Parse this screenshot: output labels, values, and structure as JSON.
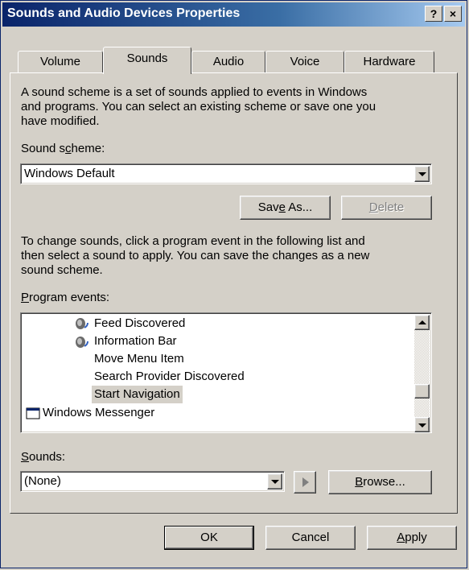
{
  "window": {
    "title": "Sounds and Audio Devices Properties",
    "help_label": "?",
    "close_label": "×"
  },
  "tabs": [
    {
      "label": "Volume",
      "active": false
    },
    {
      "label": "Sounds",
      "active": true
    },
    {
      "label": "Audio",
      "active": false
    },
    {
      "label": "Voice",
      "active": false
    },
    {
      "label": "Hardware",
      "active": false
    }
  ],
  "sounds": {
    "desc1_line1": "A sound scheme is a set of sounds applied to events in Windows",
    "desc1_line2": "and programs. You can select an existing scheme or save one you",
    "desc1_line3": "have modified.",
    "scheme_label_a": "Sound s",
    "scheme_label_u": "c",
    "scheme_label_b": "heme:",
    "scheme_value": "Windows Default",
    "save_as_a": "Sav",
    "save_as_u": "e",
    "save_as_b": " As...",
    "delete_u": "D",
    "delete_b": "elete",
    "desc2_line1": "To change sounds, click a program event in the following list and",
    "desc2_line2": "then select a sound to apply. You can save the changes as a new",
    "desc2_line3": "sound scheme.",
    "events_label_u": "P",
    "events_label_b": "rogram events:",
    "events": [
      "Feed Discovered",
      "Information Bar",
      "Move Menu Item",
      "Search Provider Discovered",
      "Start Navigation",
      "Windows Messenger"
    ],
    "sounds_label_u": "S",
    "sounds_label_b": "ounds:",
    "sound_value": "(None)",
    "browse_u": "B",
    "browse_b": "rowse..."
  },
  "footer": {
    "ok": "OK",
    "cancel": "Cancel",
    "apply_u": "A",
    "apply_b": "pply"
  }
}
